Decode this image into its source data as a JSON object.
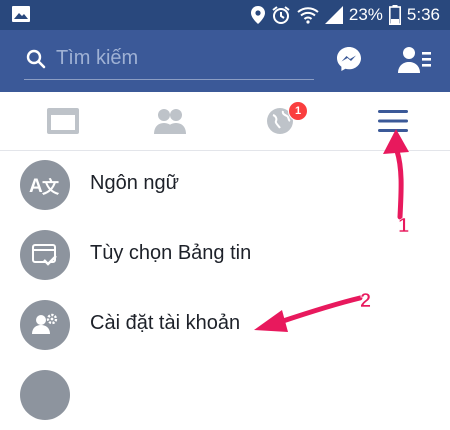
{
  "status_bar": {
    "battery_percent": "23%",
    "time": "5:36",
    "icons": [
      "gallery-icon",
      "location-icon",
      "alarm-icon",
      "wifi-icon",
      "signal-icon",
      "battery-icon"
    ]
  },
  "header": {
    "search_placeholder": "Tìm kiếm",
    "icons": [
      "search-icon",
      "messenger-icon",
      "friend-requests-icon"
    ]
  },
  "tabs": {
    "items": [
      {
        "icon": "news-feed-icon"
      },
      {
        "icon": "friends-icon"
      },
      {
        "icon": "notifications-globe-icon",
        "badge": "1"
      },
      {
        "icon": "hamburger-menu-icon"
      }
    ]
  },
  "menu": {
    "items": [
      {
        "label": "Ngôn ngữ",
        "icon": "language-icon"
      },
      {
        "label": "Tùy chọn Bảng tin",
        "icon": "news-feed-preferences-icon"
      },
      {
        "label": "Cài đặt tài khoản",
        "icon": "account-settings-icon"
      }
    ]
  },
  "annotations": {
    "step1": "1",
    "step2": "2"
  },
  "colors": {
    "brand": "#3b5998",
    "status_bar": "#29487d",
    "annotation": "#e8195d",
    "badge": "#fa3e3e",
    "menu_icon_bg": "#8d949e"
  }
}
